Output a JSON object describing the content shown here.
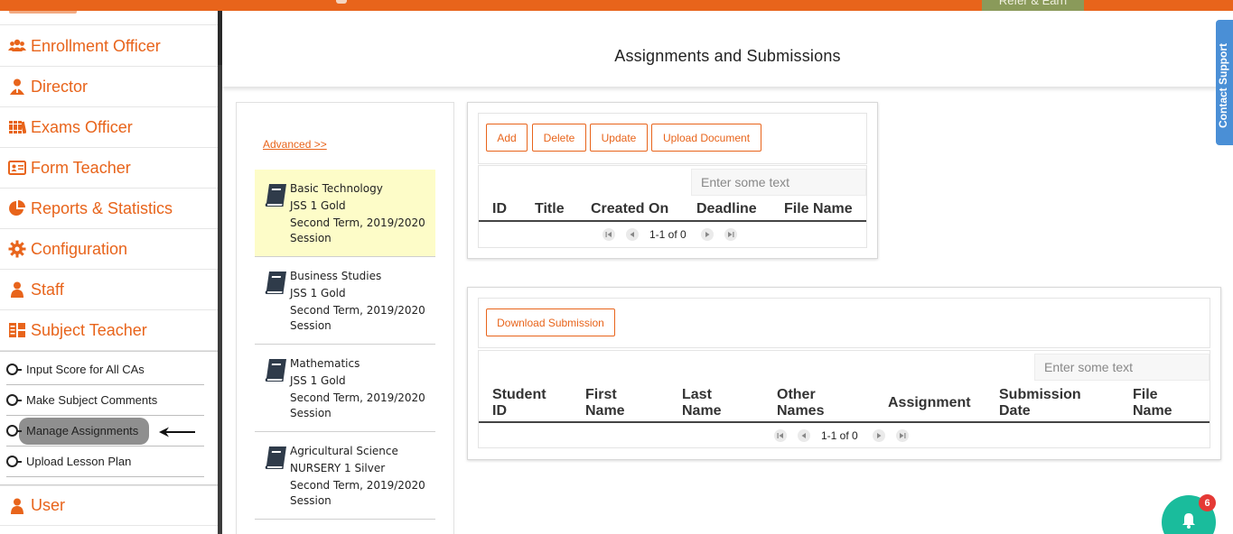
{
  "header": {
    "refer_label": "Refer & Earn"
  },
  "sidebar": {
    "items": [
      {
        "label": "Enrollment Officer",
        "icon": "users-icon"
      },
      {
        "label": "Director",
        "icon": "user-tie-icon"
      },
      {
        "label": "Exams Officer",
        "icon": "books-icon"
      },
      {
        "label": "Form Teacher",
        "icon": "id-card-icon"
      },
      {
        "label": "Reports & Statistics",
        "icon": "pie-chart-icon"
      },
      {
        "label": "Configuration",
        "icon": "gear-icon"
      },
      {
        "label": "Staff",
        "icon": "user-icon"
      },
      {
        "label": "Subject Teacher",
        "icon": "grid-icon"
      },
      {
        "label": "User",
        "icon": "user-icon"
      }
    ],
    "submenu": [
      {
        "label": "Input Score for All CAs"
      },
      {
        "label": "Make Subject Comments"
      },
      {
        "label": "Manage Assignments",
        "active": true
      },
      {
        "label": "Upload Lesson Plan"
      }
    ]
  },
  "main": {
    "title": "Assignments and Submissions"
  },
  "contact_support": "Contact Support",
  "subjects": {
    "advanced_label": "Advanced >>",
    "items": [
      {
        "name": "Basic Technology",
        "class": "JSS 1 Gold",
        "term": "Second Term, 2019/2020",
        "session": "Session",
        "selected": true
      },
      {
        "name": "Business Studies",
        "class": "JSS 1 Gold",
        "term": "Second Term, 2019/2020",
        "session": "Session"
      },
      {
        "name": "Mathematics",
        "class": "JSS 1 Gold",
        "term": "Second Term, 2019/2020",
        "session": "Session"
      },
      {
        "name": "Agricultural Science",
        "class": "NURSERY 1 Silver",
        "term": "Second Term, 2019/2020",
        "session": "Session"
      }
    ]
  },
  "assignments": {
    "buttons": {
      "add": "Add",
      "delete": "Delete",
      "update": "Update",
      "upload": "Upload Document"
    },
    "search_placeholder": "Enter some text",
    "columns": [
      "ID",
      "Title",
      "Created On",
      "Deadline",
      "File Name"
    ],
    "pager": "1-1 of 0"
  },
  "submissions": {
    "buttons": {
      "download": "Download Submission"
    },
    "search_placeholder": "Enter some text",
    "columns": [
      {
        "l1": "Student",
        "l2": "ID"
      },
      {
        "l1": "First",
        "l2": "Name"
      },
      {
        "l1": "Last",
        "l2": "Name"
      },
      {
        "l1": "Other",
        "l2": "Names"
      },
      {
        "l1": "Assignment",
        "l2": ""
      },
      {
        "l1": "Submission",
        "l2": "Date"
      },
      {
        "l1": "File",
        "l2": "Name"
      }
    ],
    "pager": "1-1 of 0"
  },
  "notifications": {
    "count": "6"
  },
  "colors": {
    "brand": "#e8641b",
    "highlight": "#fdfcc8",
    "support": "#4a8fd6",
    "bell": "#1abc9c",
    "badge": "#e53935"
  }
}
